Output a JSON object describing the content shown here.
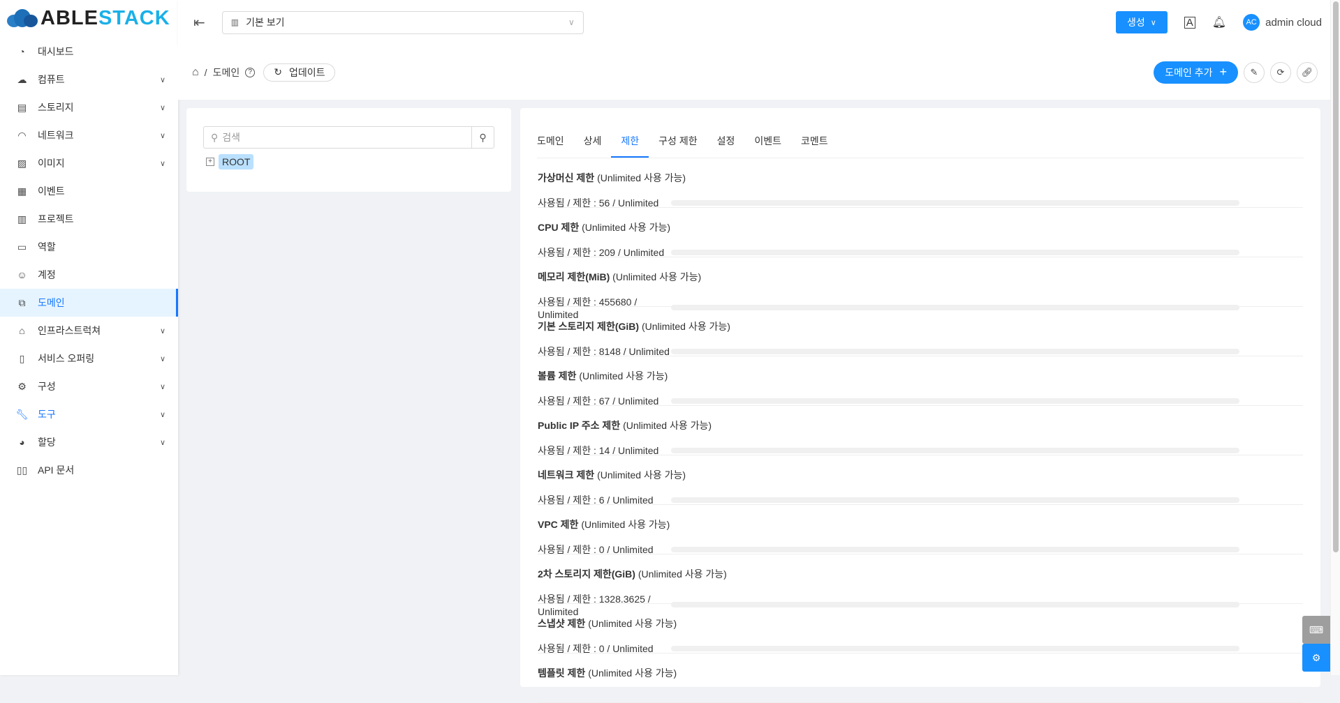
{
  "logo": {
    "part1": "ABLE",
    "part2": "STACK"
  },
  "sidebar": {
    "items": [
      {
        "label": "대시보드",
        "icon": "dashboard-icon",
        "chev": false
      },
      {
        "label": "컴퓨트",
        "icon": "cloud-icon",
        "chev": true
      },
      {
        "label": "스토리지",
        "icon": "storage-icon",
        "chev": true
      },
      {
        "label": "네트워크",
        "icon": "wifi-icon",
        "chev": true
      },
      {
        "label": "이미지",
        "icon": "picture-icon",
        "chev": true
      },
      {
        "label": "이벤트",
        "icon": "calendar-icon",
        "chev": false
      },
      {
        "label": "프로젝트",
        "icon": "project-icon",
        "chev": false
      },
      {
        "label": "역할",
        "icon": "idcard-icon",
        "chev": false
      },
      {
        "label": "계정",
        "icon": "user-icon",
        "chev": false
      },
      {
        "label": "도메인",
        "icon": "block-icon",
        "chev": false,
        "active": true
      },
      {
        "label": "인프라스트럭쳐",
        "icon": "bank-icon",
        "chev": true
      },
      {
        "label": "서비스 오퍼링",
        "icon": "shopping-icon",
        "chev": true
      },
      {
        "label": "구성",
        "icon": "setting-icon",
        "chev": true
      },
      {
        "label": "도구",
        "icon": "tool-icon",
        "chev": true,
        "blue": true
      },
      {
        "label": "할당",
        "icon": "pie-icon",
        "chev": true
      },
      {
        "label": "API 문서",
        "icon": "read-icon",
        "chev": false
      }
    ]
  },
  "header": {
    "view": "기본 보기",
    "create": "생성",
    "user_initials": "AC",
    "user": "admin cloud"
  },
  "breadcrumb": {
    "current": "도메인",
    "update": "업데이트"
  },
  "actions": {
    "add": "도메인 추가"
  },
  "tree": {
    "search_placeholder": "검색",
    "root": "ROOT"
  },
  "tabs": [
    "도메인",
    "상세",
    "제한",
    "구성 제한",
    "설정",
    "이벤트",
    "코멘트"
  ],
  "active_tab": "제한",
  "limits": [
    {
      "name": "가상머신 제한",
      "avail": "(Unlimited 사용 가능)",
      "usage": "사용됨 / 제한 : 56 / Unlimited",
      "percent": 0
    },
    {
      "name": "CPU 제한",
      "avail": "(Unlimited 사용 가능)",
      "usage": "사용됨 / 제한 : 209 / Unlimited",
      "percent": 0
    },
    {
      "name": "메모리 제한(MiB)",
      "avail": "(Unlimited 사용 가능)",
      "usage": "사용됨 / 제한 : 455680 / Unlimited",
      "percent": 0
    },
    {
      "name": "기본 스토리지 제한(GiB)",
      "avail": "(Unlimited 사용 가능)",
      "usage": "사용됨 / 제한 : 8148 / Unlimited",
      "percent": 0
    },
    {
      "name": "볼륨 제한",
      "avail": "(Unlimited 사용 가능)",
      "usage": "사용됨 / 제한 : 67 / Unlimited",
      "percent": 0
    },
    {
      "name": "Public IP 주소 제한",
      "avail": "(Unlimited 사용 가능)",
      "usage": "사용됨 / 제한 : 14 / Unlimited",
      "percent": 0
    },
    {
      "name": "네트워크 제한",
      "avail": "(Unlimited 사용 가능)",
      "usage": "사용됨 / 제한 : 6 / Unlimited",
      "percent": 0
    },
    {
      "name": "VPC 제한",
      "avail": "(Unlimited 사용 가능)",
      "usage": "사용됨 / 제한 : 0 / Unlimited",
      "percent": 0
    },
    {
      "name": "2차 스토리지 제한(GiB)",
      "avail": "(Unlimited 사용 가능)",
      "usage": "사용됨 / 제한 : 1328.3625 / Unlimited",
      "percent": 0
    },
    {
      "name": "스냅샷 제한",
      "avail": "(Unlimited 사용 가능)",
      "usage": "사용됨 / 제한 : 0 / Unlimited",
      "percent": 0
    },
    {
      "name": "템플릿 제한",
      "avail": "(Unlimited 사용 가능)",
      "usage": "",
      "percent": 0
    }
  ]
}
